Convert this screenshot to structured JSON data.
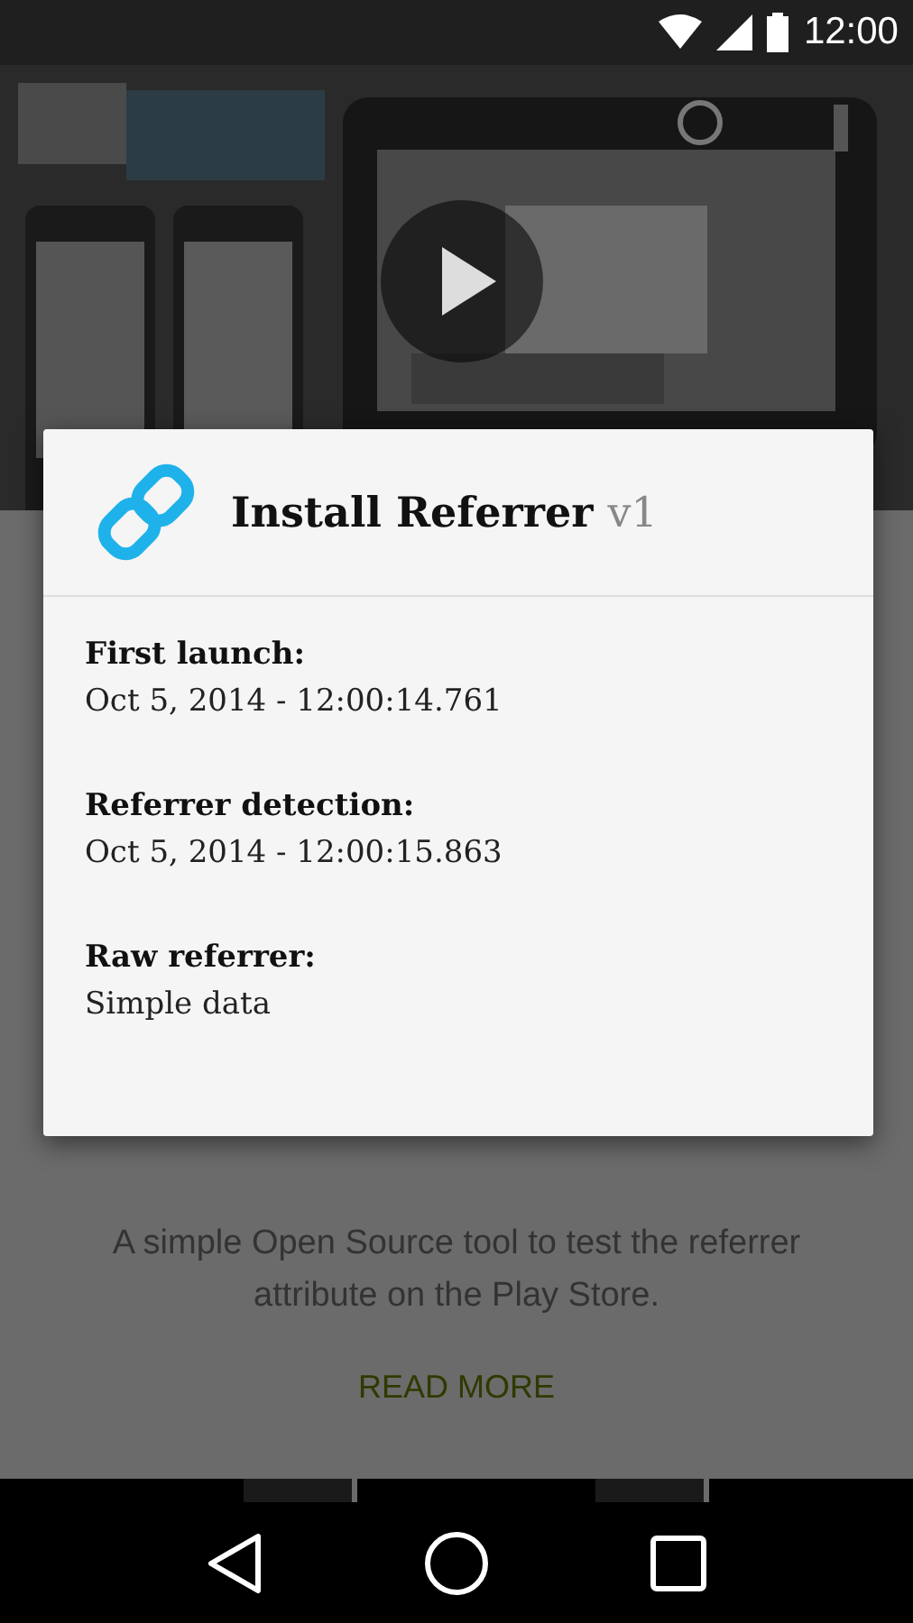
{
  "status_bar": {
    "time": "12:00"
  },
  "dialog": {
    "title": "Install Referrer",
    "version": "v1",
    "fields": [
      {
        "label": "First launch:",
        "value": "Oct 5, 2014 - 12:00:14.761"
      },
      {
        "label": "Referrer detection:",
        "value": "Oct 5, 2014 - 12:00:15.863"
      },
      {
        "label": "Raw referrer:",
        "value": "Simple data"
      }
    ]
  },
  "description": "A simple Open Source tool to test the referrer attribute on the Play Store.",
  "read_more": "READ MORE"
}
